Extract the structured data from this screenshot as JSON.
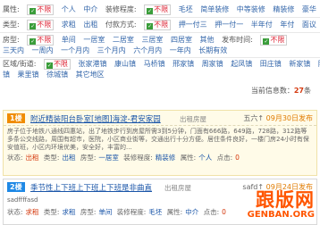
{
  "filters": {
    "row1": {
      "attr_label": "属性:",
      "attr_selected": "不限",
      "attr_options": [
        "个人",
        "中介"
      ],
      "decor_label": "装修程度:",
      "decor_selected": "不限",
      "decor_options": [
        "毛坯",
        "简单装修",
        "中等装修",
        "精装修",
        "豪华"
      ]
    },
    "row2": {
      "type_label": "类型:",
      "type_selected": "不限",
      "type_options": [
        "求租",
        "出租"
      ],
      "pay_label": "付款方式:",
      "pay_selected": "不限",
      "pay_options": [
        "押一付三",
        "押一付一",
        "半年付",
        "年付",
        "面议"
      ]
    },
    "row3": {
      "room_label": "房型:",
      "room_selected": "不限",
      "room_options": [
        "单间",
        "一居室",
        "二居室",
        "三居室",
        "四居室",
        "其他"
      ],
      "time_label": "发布时间:",
      "time_selected": "不限"
    },
    "row4": {
      "time_options": [
        "三天内",
        "一周内",
        "一个月内",
        "三个月内",
        "六个月内",
        "一年内",
        "长期有效"
      ]
    },
    "row5": {
      "area_label": "区域/街道:",
      "area_selected": "不限",
      "area_options": [
        "张家港镇",
        "康山镇",
        "马桥镇",
        "邢家镇",
        "周家镇",
        "起凤镇",
        "田庄镇",
        "新家镇",
        "陈庄"
      ]
    },
    "row6": {
      "area_options": [
        "镇",
        "果里镇",
        "徐城镇",
        "其它地区"
      ]
    }
  },
  "total": {
    "prefix": "当前信息数：",
    "count": "27",
    "suffix": "条"
  },
  "listings": [
    {
      "num": "1楼",
      "title": "附近精装阳台卧室[地图]海淀-君安家园",
      "tag": "出租房屋",
      "weekday": "五六↑",
      "date": "09月30日发布",
      "desc": "房子位于地铁八通线四惠站，出了地铁步行到房屋所需3到5分钟，门面有666路，649路，728路，312路等多条公交线路，周围有超市，医院，小区商业街等，交通出行十分方便。居住条件良好，一楼门房24小时有保安值班，小区内环境优美，安全好，丰富的...",
      "meta": [
        {
          "k": "状态:",
          "v": "出租"
        },
        {
          "k": "类型:",
          "v": "出租"
        },
        {
          "k": "房型:",
          "v": "一居室"
        },
        {
          "k": "装修程度:",
          "v": "精装修"
        },
        {
          "k": "属性:",
          "v": "个人"
        },
        {
          "k": "点击:",
          "v": "0"
        }
      ]
    },
    {
      "num": "2楼",
      "title": "季节性上下班上下班上下班是非曲直",
      "tag": "出租房屋",
      "weekday": "safd↑",
      "date": "09月24日发布",
      "desc": "sadffffasd",
      "meta": [
        {
          "k": "状态:",
          "v": "求租"
        },
        {
          "k": "类型:",
          "v": "求租"
        },
        {
          "k": "房型:",
          "v": "单间"
        },
        {
          "k": "装修程度:",
          "v": "毛坯"
        },
        {
          "k": "属性:",
          "v": "中介"
        },
        {
          "k": "点击:",
          "v": "0"
        }
      ]
    }
  ],
  "watermark": {
    "brand": "跟版网",
    "url": "GENBAN.ORG"
  }
}
